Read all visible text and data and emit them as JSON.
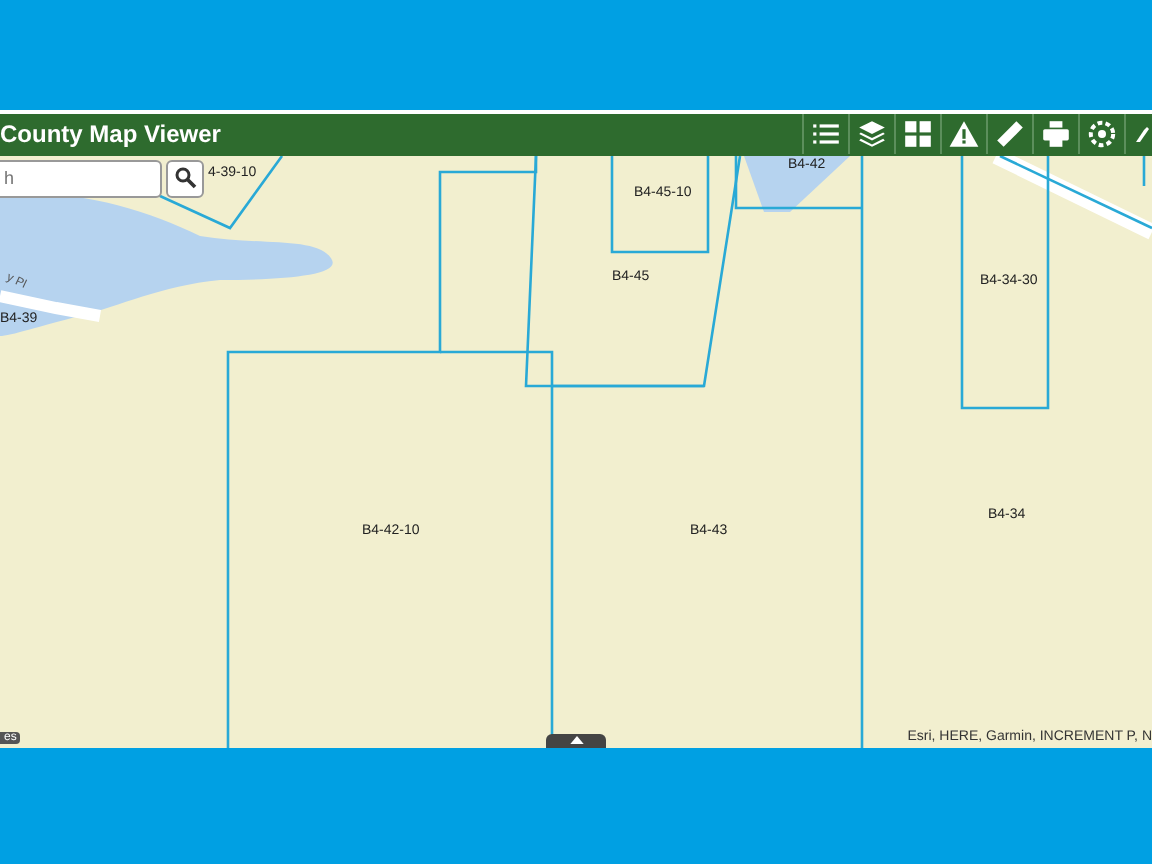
{
  "header": {
    "title": "County Map Viewer"
  },
  "search": {
    "placeholder": "h"
  },
  "map": {
    "parcel_labels": [
      "4-39-10",
      "B4-45-10",
      "B4-42",
      "B4-45",
      "B4-39",
      "B4-34-30",
      "B4-42-10",
      "B4-43",
      "B4-34"
    ],
    "road_label": "y Pl",
    "corner_badge": "es",
    "attribution": "Esri, HERE, Garmin, INCREMENT P, N"
  }
}
